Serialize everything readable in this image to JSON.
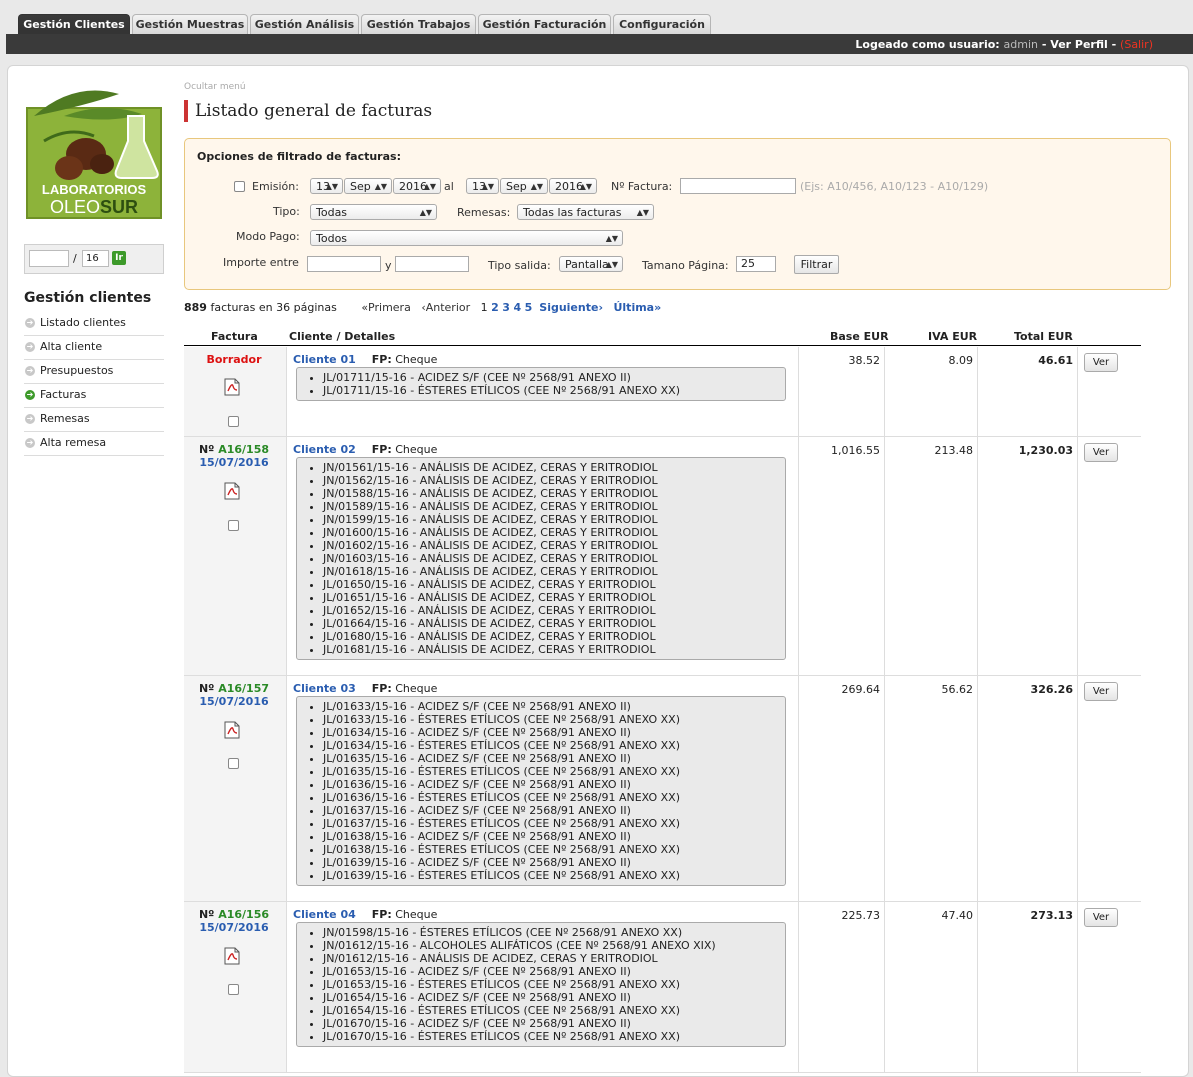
{
  "tabs": [
    {
      "label": "Gestión Clientes",
      "active": true
    },
    {
      "label": "Gestión Muestras",
      "active": false
    },
    {
      "label": "Gestión Análisis",
      "active": false
    },
    {
      "label": "Gestión Trabajos",
      "active": false
    },
    {
      "label": "Gestión Facturación",
      "active": false
    },
    {
      "label": "Configuración",
      "active": false
    }
  ],
  "userbar": {
    "logged_label": "Logeado como usuario:",
    "username": "admin",
    "separator": "-",
    "profile": "Ver Perfil",
    "logout": "(Salir)"
  },
  "logo": {
    "line1": "LABORATORIOS",
    "line2a": "OLEO",
    "line2b": "SUR"
  },
  "sidebar": {
    "page_input": "",
    "page_sep": "/",
    "page_total": "16",
    "go_label": "Ir",
    "title": "Gestión clientes",
    "items": [
      {
        "label": "Listado clientes",
        "active": false
      },
      {
        "label": "Alta cliente",
        "active": false
      },
      {
        "label": "Presupuestos",
        "active": false
      },
      {
        "label": "Facturas",
        "active": true
      },
      {
        "label": "Remesas",
        "active": false
      },
      {
        "label": "Alta remesa",
        "active": false
      }
    ]
  },
  "hide_menu": "Ocultar menú",
  "page_title": "Listado general de facturas",
  "filter": {
    "title": "Opciones de filtrado de facturas:",
    "emision_label": "Emisión:",
    "from_day": "13",
    "from_month": "Sep",
    "from_year": "2016",
    "al_label": "al",
    "to_day": "13",
    "to_month": "Sep",
    "to_year": "2016",
    "nfactura_label": "Nº Factura:",
    "nfactura_value": "",
    "nfactura_hint": "(Ejs: A10/456, A10/123 - A10/129)",
    "tipo_label": "Tipo:",
    "tipo_value": "Todas",
    "remesas_label": "Remesas:",
    "remesas_value": "Todas las facturas",
    "modo_label": "Modo Pago:",
    "modo_value": "Todos",
    "importe_label": "Importe entre",
    "y_label": "y",
    "importe_from": "",
    "importe_to": "",
    "salida_label": "Tipo salida:",
    "salida_value": "Pantalla",
    "tamano_label": "Tamano Página:",
    "tamano_value": "25",
    "filtrar": "Filtrar"
  },
  "summary": {
    "count": "889",
    "text": "facturas en 36 páginas",
    "first": "«Primera",
    "prev": "‹Anterior",
    "current": "1",
    "pages": [
      "2",
      "3",
      "4",
      "5"
    ],
    "next": "Siguiente›",
    "last": "Última»"
  },
  "table": {
    "headers": {
      "factura": "Factura",
      "cliente": "Cliente / Detalles",
      "base": "Base EUR",
      "iva": "IVA EUR",
      "total": "Total EUR"
    },
    "ver_label": "Ver",
    "fp_label": "FP:",
    "rows": [
      {
        "status": "Borrador",
        "number_prefix": "",
        "number": "",
        "date": "",
        "client": "Cliente 01",
        "fp": "Cheque",
        "items": [
          "JL/01711/15-16 - ACIDEZ S/F (CEE Nº 2568/91 ANEXO II)",
          "JL/01711/15-16 - ÉSTERES ETÍLICOS (CEE Nº 2568/91 ANEXO XX)"
        ],
        "base": "38.52",
        "iva": "8.09",
        "total": "46.61"
      },
      {
        "status": "",
        "number_prefix": "Nº",
        "number": "A16/158",
        "date": "15/07/2016",
        "client": "Cliente 02",
        "fp": "Cheque",
        "items": [
          "JN/01561/15-16 - ANÁLISIS DE ACIDEZ, CERAS Y ERITRODIOL",
          "JN/01562/15-16 - ANÁLISIS DE ACIDEZ, CERAS Y ERITRODIOL",
          "JN/01588/15-16 - ANÁLISIS DE ACIDEZ, CERAS Y ERITRODIOL",
          "JN/01589/15-16 - ANÁLISIS DE ACIDEZ, CERAS Y ERITRODIOL",
          "JN/01599/15-16 - ANÁLISIS DE ACIDEZ, CERAS Y ERITRODIOL",
          "JN/01600/15-16 - ANÁLISIS DE ACIDEZ, CERAS Y ERITRODIOL",
          "JN/01602/15-16 - ANÁLISIS DE ACIDEZ, CERAS Y ERITRODIOL",
          "JN/01603/15-16 - ANÁLISIS DE ACIDEZ, CERAS Y ERITRODIOL",
          "JN/01618/15-16 - ANÁLISIS DE ACIDEZ, CERAS Y ERITRODIOL",
          "JL/01650/15-16 - ANÁLISIS DE ACIDEZ, CERAS Y ERITRODIOL",
          "JL/01651/15-16 - ANÁLISIS DE ACIDEZ, CERAS Y ERITRODIOL",
          "JL/01652/15-16 - ANÁLISIS DE ACIDEZ, CERAS Y ERITRODIOL",
          "JL/01664/15-16 - ANÁLISIS DE ACIDEZ, CERAS Y ERITRODIOL",
          "JL/01680/15-16 - ANÁLISIS DE ACIDEZ, CERAS Y ERITRODIOL",
          "JL/01681/15-16 - ANÁLISIS DE ACIDEZ, CERAS Y ERITRODIOL"
        ],
        "base": "1,016.55",
        "iva": "213.48",
        "total": "1,230.03"
      },
      {
        "status": "",
        "number_prefix": "Nº",
        "number": "A16/157",
        "date": "15/07/2016",
        "client": "Cliente 03",
        "fp": "Cheque",
        "items": [
          "JL/01633/15-16 - ACIDEZ S/F (CEE Nº 2568/91 ANEXO II)",
          "JL/01633/15-16 - ÉSTERES ETÍLICOS (CEE Nº 2568/91 ANEXO XX)",
          "JL/01634/15-16 - ACIDEZ S/F (CEE Nº 2568/91 ANEXO II)",
          "JL/01634/15-16 - ÉSTERES ETÍLICOS (CEE Nº 2568/91 ANEXO XX)",
          "JL/01635/15-16 - ACIDEZ S/F (CEE Nº 2568/91 ANEXO II)",
          "JL/01635/15-16 - ÉSTERES ETÍLICOS (CEE Nº 2568/91 ANEXO XX)",
          "JL/01636/15-16 - ACIDEZ S/F (CEE Nº 2568/91 ANEXO II)",
          "JL/01636/15-16 - ÉSTERES ETÍLICOS (CEE Nº 2568/91 ANEXO XX)",
          "JL/01637/15-16 - ACIDEZ S/F (CEE Nº 2568/91 ANEXO II)",
          "JL/01637/15-16 - ÉSTERES ETÍLICOS (CEE Nº 2568/91 ANEXO XX)",
          "JL/01638/15-16 - ACIDEZ S/F (CEE Nº 2568/91 ANEXO II)",
          "JL/01638/15-16 - ÉSTERES ETÍLICOS (CEE Nº 2568/91 ANEXO XX)",
          "JL/01639/15-16 - ACIDEZ S/F (CEE Nº 2568/91 ANEXO II)",
          "JL/01639/15-16 - ÉSTERES ETÍLICOS (CEE Nº 2568/91 ANEXO XX)"
        ],
        "base": "269.64",
        "iva": "56.62",
        "total": "326.26"
      },
      {
        "status": "",
        "number_prefix": "Nº",
        "number": "A16/156",
        "date": "15/07/2016",
        "client": "Cliente 04",
        "fp": "Cheque",
        "items": [
          "JN/01598/15-16 - ÉSTERES ETÍLICOS (CEE Nº 2568/91 ANEXO XX)",
          "JN/01612/15-16 - ALCOHOLES ALIFÁTICOS (CEE Nº 2568/91 ANEXO XIX)",
          "JN/01612/15-16 - ANÁLISIS DE ACIDEZ, CERAS Y ERITRODIOL",
          "JL/01653/15-16 - ACIDEZ S/F (CEE Nº 2568/91 ANEXO II)",
          "JL/01653/15-16 - ÉSTERES ETÍLICOS (CEE Nº 2568/91 ANEXO XX)",
          "JL/01654/15-16 - ACIDEZ S/F (CEE Nº 2568/91 ANEXO II)",
          "JL/01654/15-16 - ÉSTERES ETÍLICOS (CEE Nº 2568/91 ANEXO XX)",
          "JL/01670/15-16 - ACIDEZ S/F (CEE Nº 2568/91 ANEXO II)",
          "JL/01670/15-16 - ÉSTERES ETÍLICOS (CEE Nº 2568/91 ANEXO XX)"
        ],
        "base": "225.73",
        "iva": "47.40",
        "total": "273.13"
      }
    ]
  }
}
